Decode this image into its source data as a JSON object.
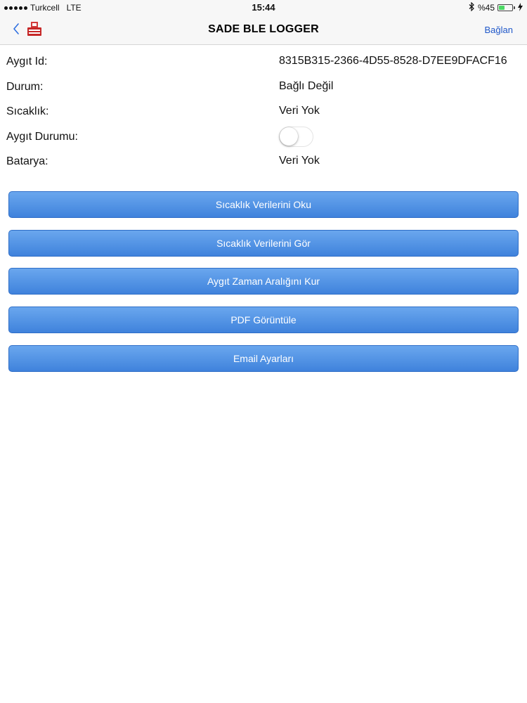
{
  "status_bar": {
    "carrier": "Turkcell",
    "network": "LTE",
    "time": "15:44",
    "battery_text": "%45",
    "battery_level": 0.45,
    "battery_color": "#4cd964"
  },
  "nav": {
    "title": "SADE BLE LOGGER",
    "connect_label": "Bağlan",
    "back_icon": "chevron-left-icon",
    "accent_color": "#1f57c9"
  },
  "info": {
    "rows": [
      {
        "label": "Aygıt Id:",
        "value": "8315B315-2366-4D55-8528-D7EE9DFACF16"
      },
      {
        "label": "Durum:",
        "value": "Bağlı Değil"
      },
      {
        "label": "Sıcaklık:",
        "value": "Veri Yok"
      },
      {
        "label": "Aygıt Durumu:",
        "toggle_on": false
      },
      {
        "label": "Batarya:",
        "value": "Veri Yok"
      }
    ]
  },
  "buttons": [
    {
      "label": "Sıcaklık Verilerini Oku"
    },
    {
      "label": "Sıcaklık Verilerini Gör"
    },
    {
      "label": "Aygıt Zaman Aralığını Kur"
    },
    {
      "label": "PDF Görüntüle"
    },
    {
      "label": "Email Ayarları"
    }
  ],
  "colors": {
    "button_top": "#6aa7ee",
    "button_bottom": "#3f82dc"
  }
}
